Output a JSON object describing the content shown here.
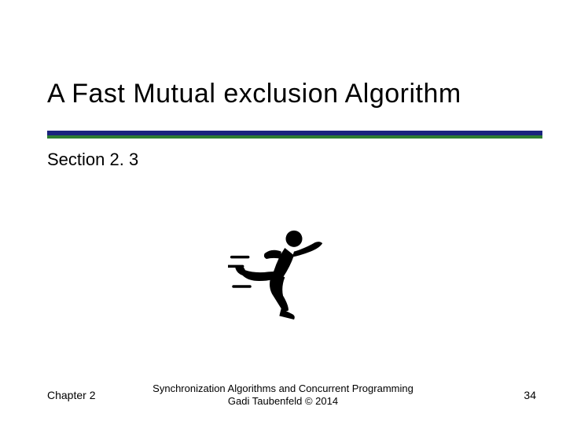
{
  "title": "A Fast Mutual exclusion Algorithm",
  "section": "Section 2. 3",
  "footer": {
    "left": "Chapter 2",
    "center_line1": "Synchronization Algorithms and Concurrent Programming",
    "center_line2": "Gadi Taubenfeld © 2014",
    "page_number": "34"
  },
  "colors": {
    "rule_top": "#1a237e",
    "rule_bottom": "#2e7d32"
  }
}
